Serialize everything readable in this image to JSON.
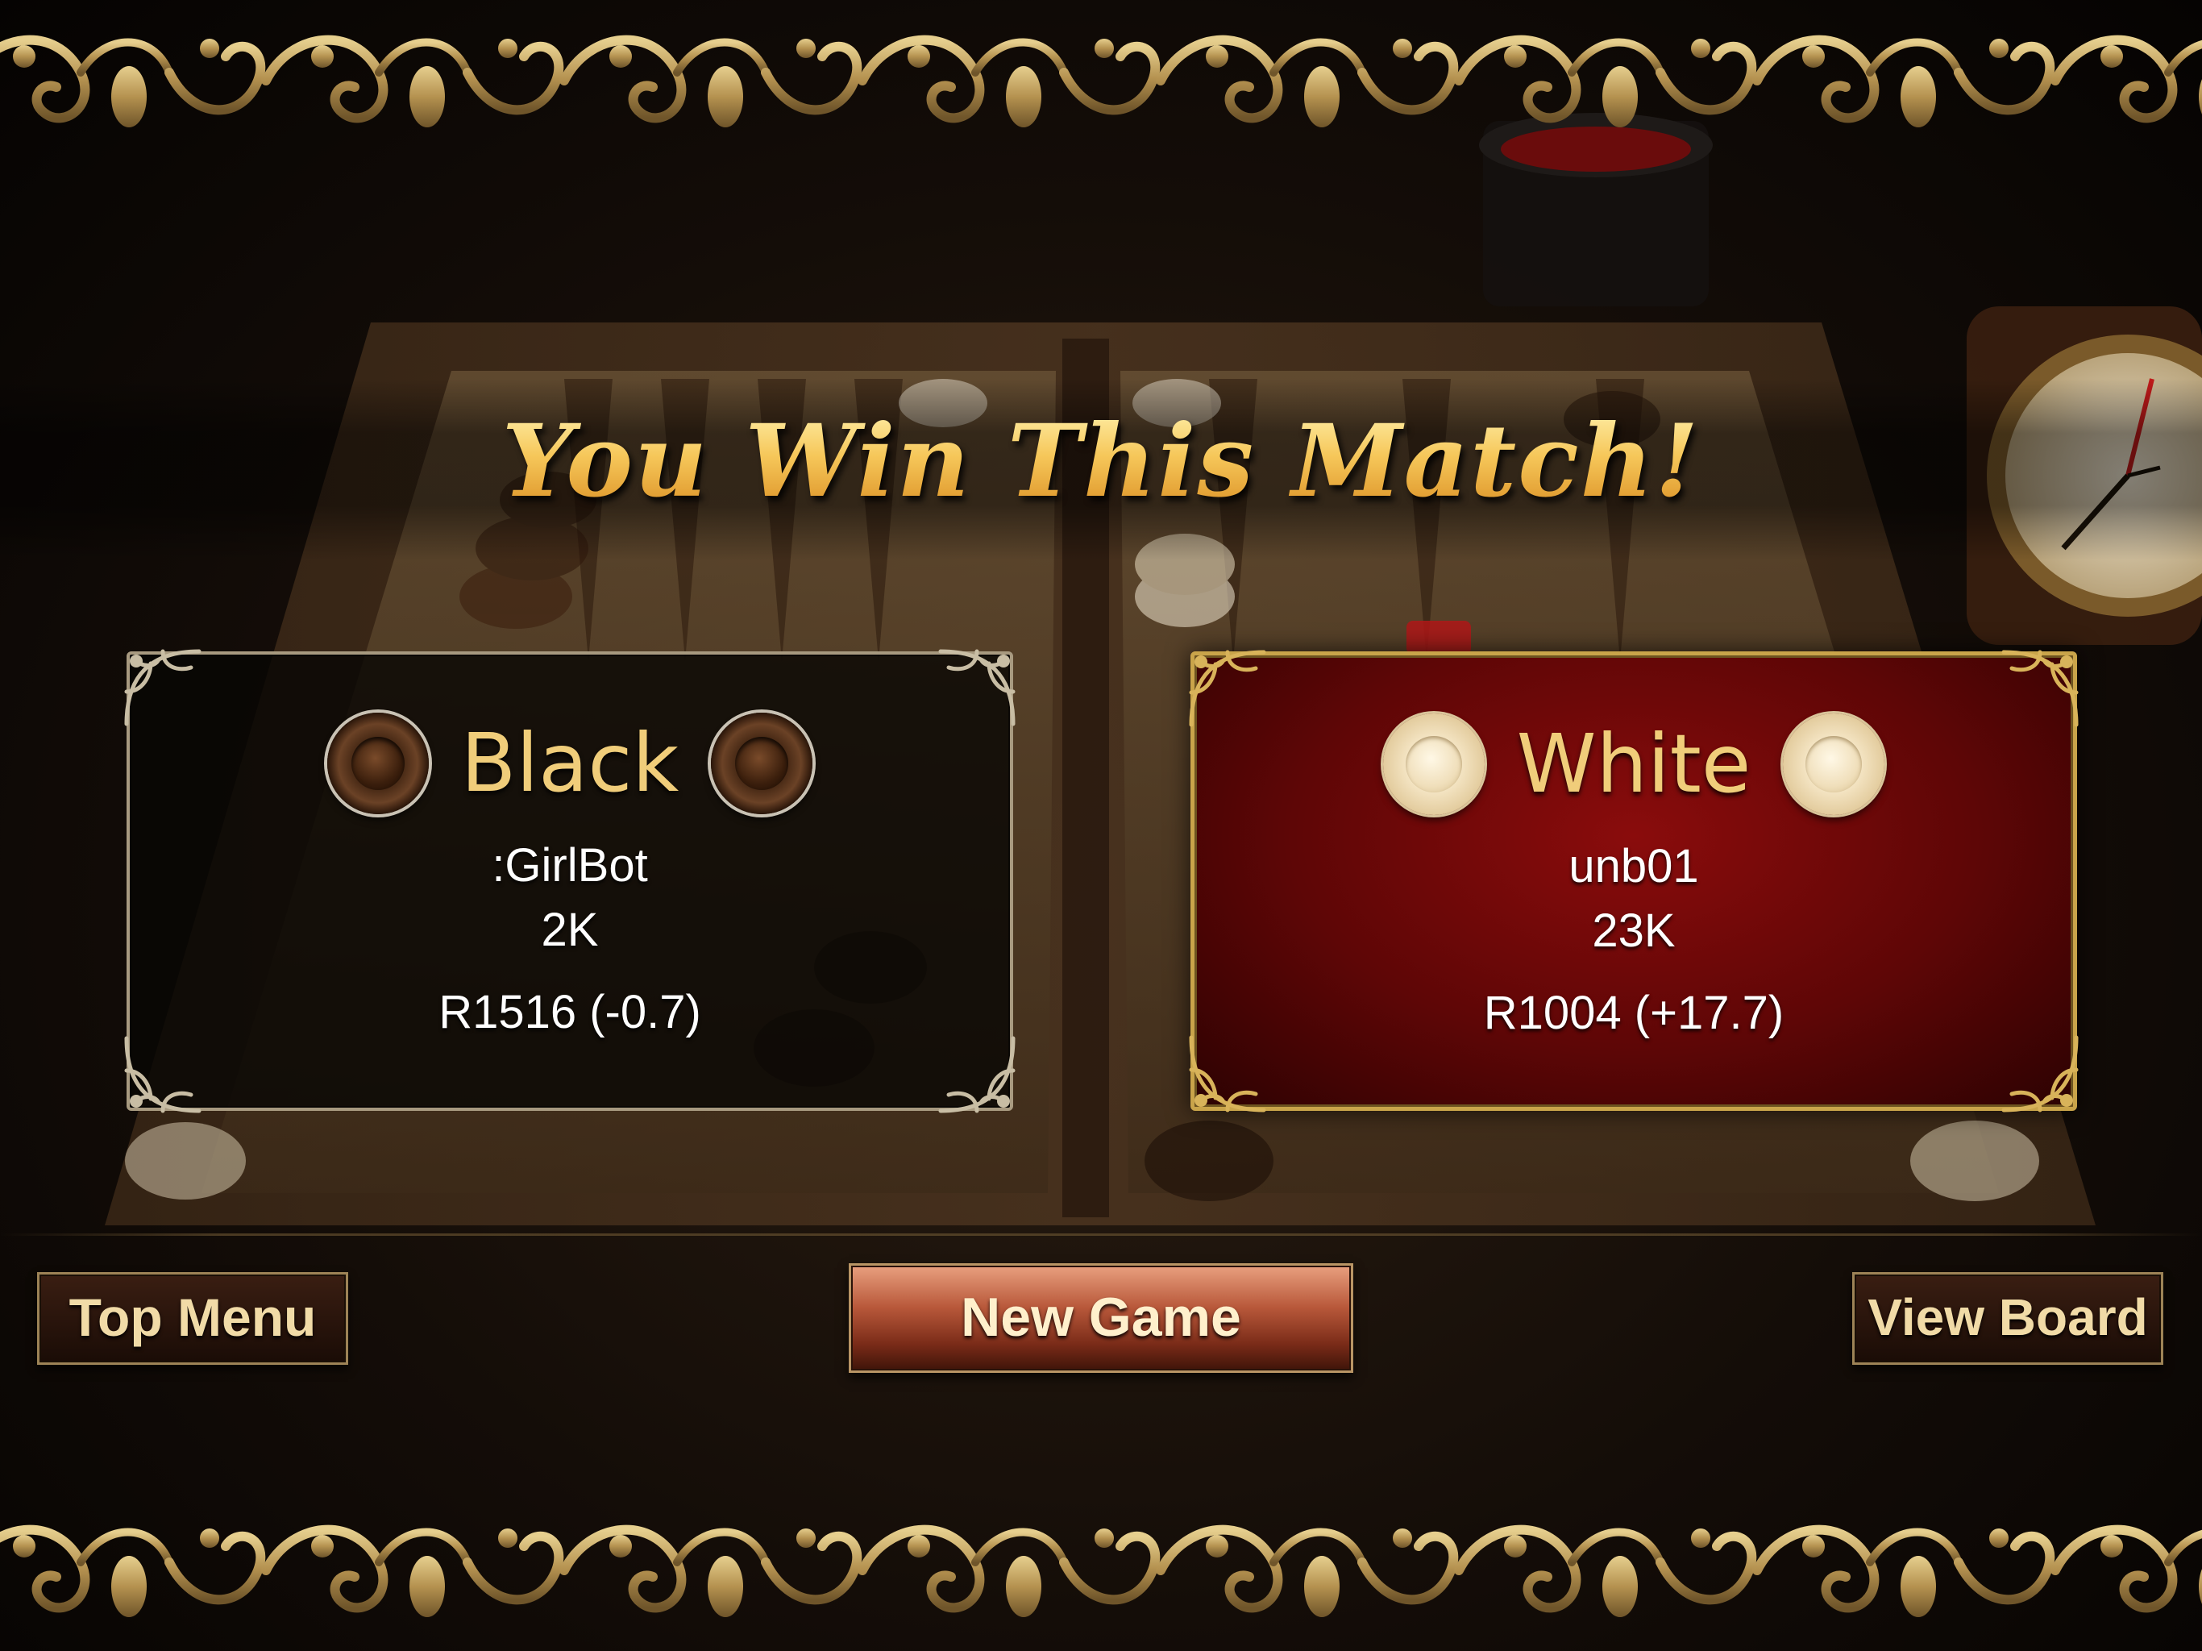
{
  "title": "You Win This Match!",
  "players": {
    "black": {
      "side_label": "Black",
      "name": ":GirlBot",
      "games": "2K",
      "rating": "R1516 (-0.7)"
    },
    "white": {
      "side_label": "White",
      "name": "unb01",
      "games": "23K",
      "rating": "R1004 (+17.7)"
    }
  },
  "buttons": {
    "top_menu": "Top Menu",
    "new_game": "New Game",
    "view_board": "View Board"
  },
  "colors": {
    "title_gold": "#f4c253",
    "winner_panel_red": "#8a0c0c",
    "frame_gold": "#c9a44a",
    "side_label_gold": "#f0cd7a"
  },
  "icons": {
    "black_checker": "black-checker-icon",
    "white_checker": "white-checker-icon",
    "ornament": "gold-scroll-ornament"
  }
}
